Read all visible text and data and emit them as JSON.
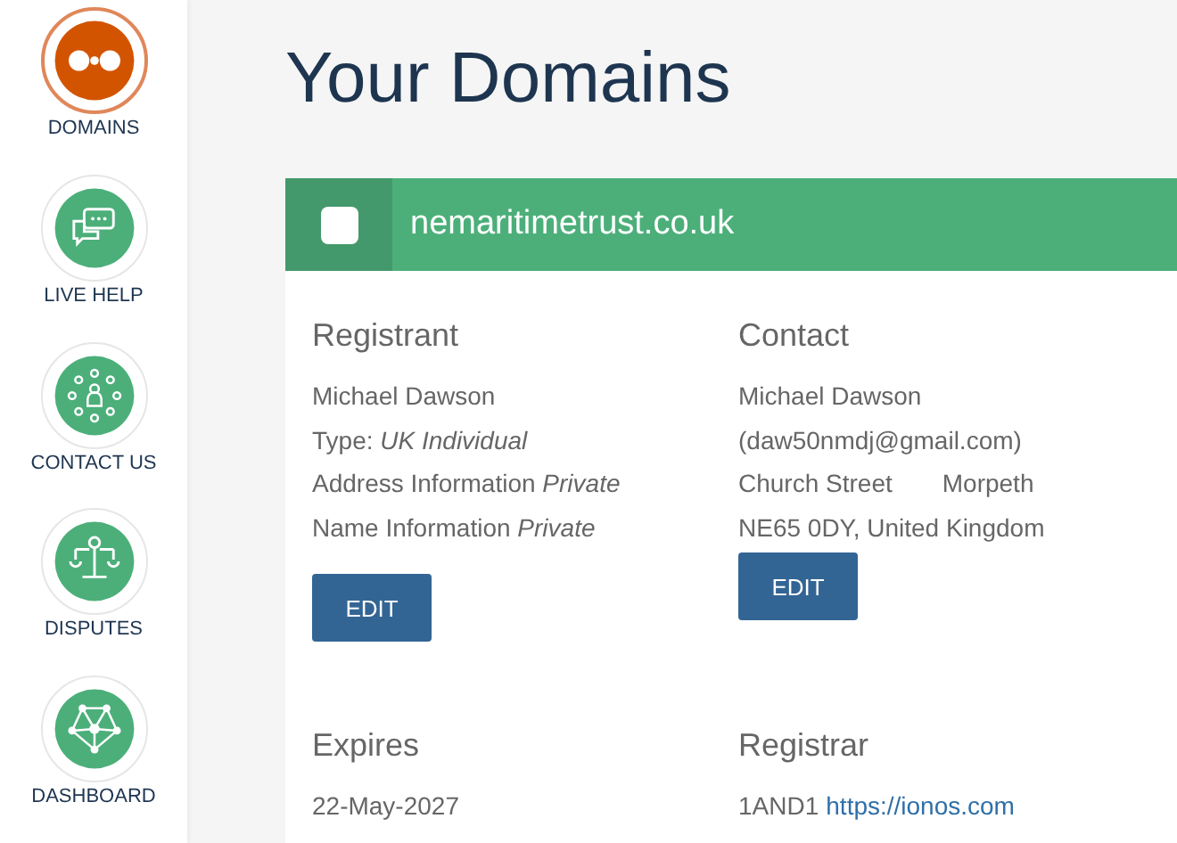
{
  "sidebar": {
    "items": [
      {
        "label": "DOMAINS",
        "kind": "domains",
        "selected": true
      },
      {
        "label": "LIVE HELP",
        "kind": "chat",
        "selected": false
      },
      {
        "label": "CONTACT US",
        "kind": "contact",
        "selected": false
      },
      {
        "label": "DISPUTES",
        "kind": "scales",
        "selected": false
      },
      {
        "label": "DASHBOARD",
        "kind": "network",
        "selected": false
      }
    ]
  },
  "page_title": "Your Domains",
  "domain_card": {
    "domain": "nemaritimetrust.co.uk",
    "checked": false,
    "sections": [
      {
        "heading": "Registrant",
        "lines": [
          [
            "Michael Dawson"
          ],
          [
            "Type: *UK Individual*"
          ],
          [
            "Address Information *Private*"
          ],
          [
            "Name Information *Private*"
          ]
        ],
        "button": "EDIT"
      },
      {
        "heading": "Contact",
        "lines": [
          [
            "Michael Dawson"
          ],
          [
            "(daw50nmdj@gmail.com)"
          ],
          [
            "Church Street",
            "Morpeth"
          ],
          [
            "NE65 0DY, United Kingdom"
          ]
        ],
        "button": "EDIT"
      },
      {
        "heading": "Expires",
        "value": "22-May-2027"
      },
      {
        "heading": "Registrar",
        "value": "1AND1",
        "link": "https://ionos.com"
      }
    ]
  }
}
